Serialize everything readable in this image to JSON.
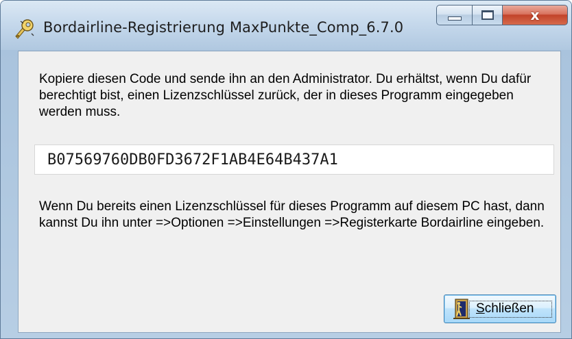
{
  "window": {
    "title": "Bordairline-Registrierung MaxPunkte_Comp_6.7.0",
    "icons": {
      "app": "key-icon",
      "minimize": "minimize-icon",
      "maximize": "maximize-icon",
      "close": "close-icon"
    },
    "close_glyph": "x"
  },
  "main": {
    "intro_text": "Kopiere diesen Code und sende ihn an den Administrator. Du erhältst, wenn Du dafür berechtigt bist, einen Lizenzschlüssel zurück, der in dieses Programm eingegeben werden muss.",
    "code_value": "B07569760DB0FD3672F1AB4E64B437A1",
    "info_text": "Wenn Du bereits einen Lizenzschlüssel für dieses Programm auf diesem PC hast, dann kannst Du ihn unter =>Optionen =>Einstellungen =>Registerkarte Bordairline eingeben.",
    "close_button": {
      "accel_char": "S",
      "label_rest": "chließen",
      "icon": "exit-door-icon"
    }
  },
  "colors": {
    "close_accent": "#c2432a",
    "button_focus": "#3c7fb1"
  }
}
